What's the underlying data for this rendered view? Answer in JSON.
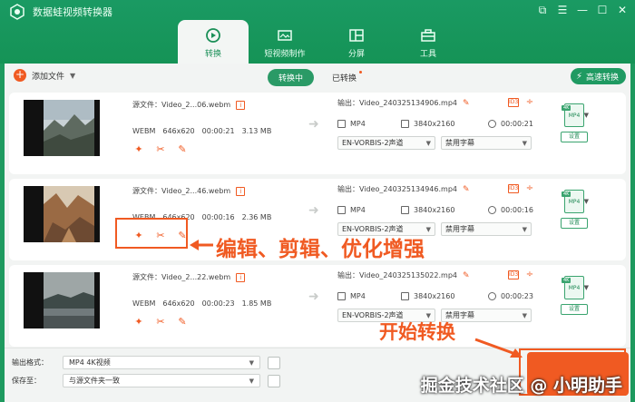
{
  "app": {
    "title": "数据蛙视频转换器",
    "win_buttons": [
      "⧉",
      "☰",
      "—",
      "☐",
      "✕"
    ]
  },
  "nav": [
    {
      "label": "转换",
      "icon": "convert-icon",
      "active": true
    },
    {
      "label": "短视频制作",
      "icon": "video-maker-icon",
      "active": false
    },
    {
      "label": "分屏",
      "icon": "split-screen-icon",
      "active": false
    },
    {
      "label": "工具",
      "icon": "toolbox-icon",
      "active": false
    }
  ],
  "toolbar": {
    "add_label": "添加文件",
    "tab_converting": "转换中",
    "tab_converted": "已转换",
    "fast_label": "高速转换"
  },
  "rows": [
    {
      "src": "源文件：Video_2...06.webm",
      "fmt": "WEBM",
      "res": "646x620",
      "dur": "00:00:21",
      "size": "3.13 MB",
      "out": "输出：Video_240325134906.mp4",
      "out_fmt": "MP4",
      "out_res": "3840x2160",
      "out_dur": "00:00:21",
      "audio": "EN-VORBIS-2声道",
      "subtitle": "禁用字幕"
    },
    {
      "src": "源文件：Video_2...46.webm",
      "fmt": "WEBM",
      "res": "646x620",
      "dur": "00:00:16",
      "size": "2.36 MB",
      "out": "输出：Video_240325134946.mp4",
      "out_fmt": "MP4",
      "out_res": "3840x2160",
      "out_dur": "00:00:16",
      "audio": "EN-VORBIS-2声道",
      "subtitle": "禁用字幕"
    },
    {
      "src": "源文件：Video_2...22.webm",
      "fmt": "WEBM",
      "res": "646x620",
      "dur": "00:00:23",
      "size": "1.85 MB",
      "out": "输出：Video_240325135022.mp4",
      "out_fmt": "MP4",
      "out_res": "3840x2160",
      "out_dur": "00:00:23",
      "audio": "EN-VORBIS-2声道",
      "subtitle": "禁用字幕"
    }
  ],
  "target_format_badge": "MP4",
  "setting_label": "设置",
  "bottom": {
    "output_format_label": "输出格式：",
    "output_format_value": "MP4 4K视频",
    "save_to_label": "保存至：",
    "save_to_value": "与源文件夹一致"
  },
  "annotations": {
    "edit_note": "编辑、剪辑、优化增强",
    "start_note": "开始转换",
    "watermark": "掘金技术社区 @ 小明助手"
  },
  "colors": {
    "brand_green": "#1e9a5f",
    "accent_orange": "#f05a22"
  }
}
